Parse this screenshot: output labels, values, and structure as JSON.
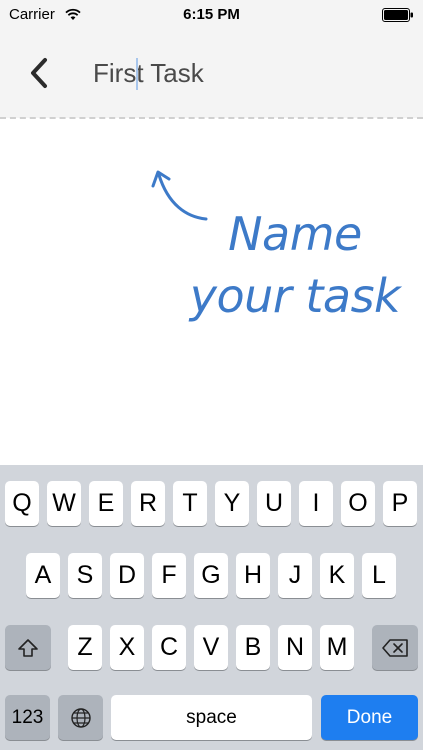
{
  "status_bar": {
    "carrier": "Carrier",
    "time": "6:15 PM",
    "wifi_icon": "wifi-icon",
    "battery_icon": "battery-icon"
  },
  "header": {
    "back_icon": "chevron-left-icon",
    "title_value": "First Task"
  },
  "hint": {
    "line1": "Name",
    "line2": "your task",
    "color": "#3d7ac8"
  },
  "keyboard": {
    "row1": [
      "Q",
      "W",
      "E",
      "R",
      "T",
      "Y",
      "U",
      "I",
      "O",
      "P"
    ],
    "row2": [
      "A",
      "S",
      "D",
      "F",
      "G",
      "H",
      "J",
      "K",
      "L"
    ],
    "row3": [
      "Z",
      "X",
      "C",
      "V",
      "B",
      "N",
      "M"
    ],
    "shift_icon": "shift-icon",
    "delete_icon": "backspace-icon",
    "numbers_label": "123",
    "globe_icon": "globe-icon",
    "space_label": "space",
    "done_label": "Done",
    "done_color": "#1e7ef0"
  }
}
